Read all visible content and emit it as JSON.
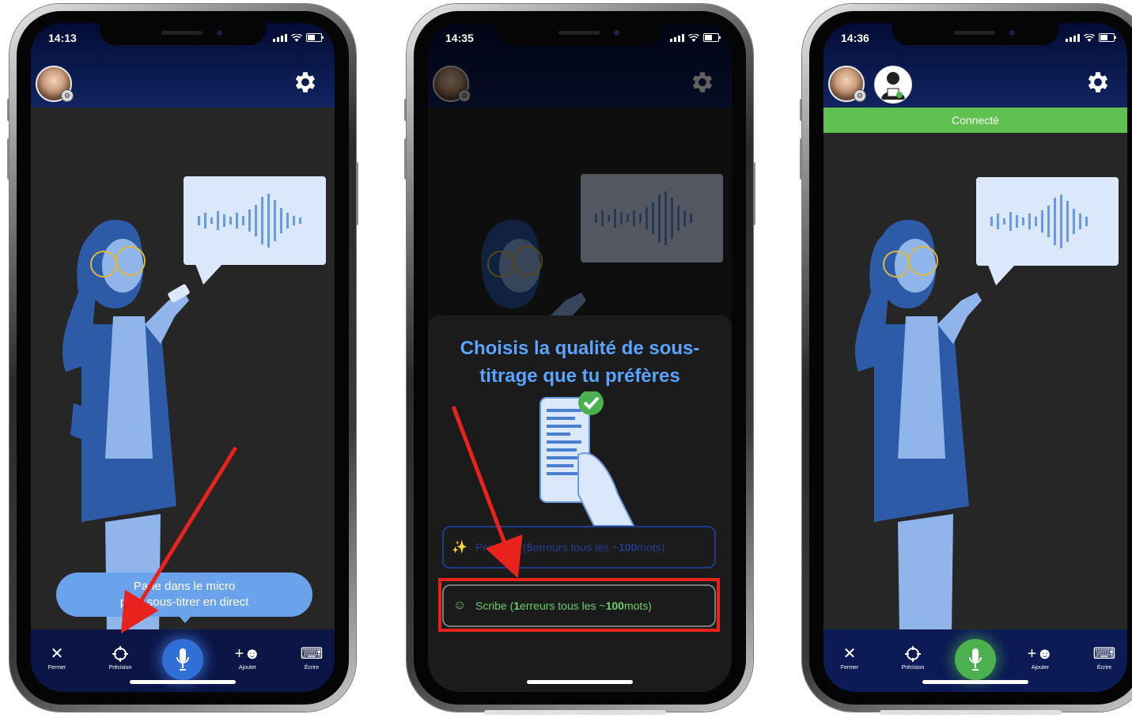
{
  "phones": [
    {
      "time": "14:13",
      "tooltip": {
        "line1": "Parle dans le micro",
        "line2": "pour sous-titrer en direct"
      },
      "toolbar": {
        "close": "Fermer",
        "precision": "Précision",
        "add": "Ajouter",
        "write": "Écrire"
      },
      "icons": [
        "close-icon",
        "precision-icon",
        "mic-icon",
        "add-user-icon",
        "keyboard-icon",
        "gear-icon"
      ]
    },
    {
      "time": "14:35",
      "sheet": {
        "title_line1": "Choisis la qualité de sous-",
        "title_line2": "titrage que tu préfères",
        "premium": {
          "name": "Premium",
          "count": "5",
          "mid": " erreurs tous les ~",
          "words": "100",
          "end": " mots)"
        },
        "scribe": {
          "name": "Scribe",
          "count": "1",
          "mid": " erreurs tous les ~",
          "words": "100",
          "end": " mots)"
        }
      }
    },
    {
      "time": "14:36",
      "connected": "Connecté",
      "toolbar": {
        "close": "Fermer",
        "precision": "Précision",
        "add": "Ajouter",
        "write": "Écrire"
      }
    }
  ],
  "colors": {
    "header": "#0a1a4e",
    "content": "#262626",
    "accent_blue": "#5aa3ff",
    "tooltip": "#6aa3ec",
    "connected": "#5fc24e",
    "annotation_red": "#e8231e",
    "mic_active_blue": "#2f6fd6",
    "mic_active_green": "#4caf50"
  }
}
